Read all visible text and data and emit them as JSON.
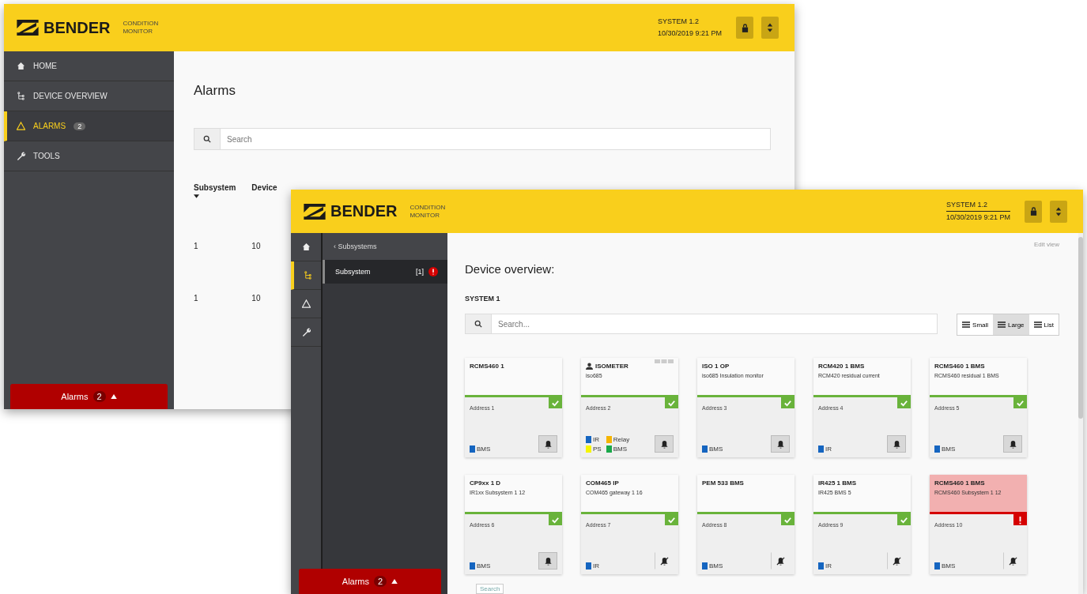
{
  "back_window": {
    "logo": "BENDER",
    "logo_subtitle": [
      "CONDITION",
      "MONITOR"
    ],
    "system": "SYSTEM 1.2",
    "datetime": "10/30/2019 9:21 PM",
    "menu": [
      {
        "label": "HOME",
        "selected": false
      },
      {
        "label": "DEVICE OVERVIEW",
        "selected": false
      },
      {
        "label": "ALARMS",
        "selected": true,
        "badge": "2"
      },
      {
        "label": "TOOLS",
        "selected": false
      }
    ],
    "alarm_button": {
      "label": "Alarms",
      "count": "2"
    },
    "title": "Alarms",
    "search": {
      "placeholder": "Search"
    },
    "table": {
      "columns": [
        "Subsystem",
        "Device"
      ],
      "rows": [
        [
          "1",
          "10"
        ],
        [
          "1",
          "10"
        ]
      ]
    }
  },
  "front_window": {
    "logo": "BENDER",
    "logo_subtitle": [
      "CONDITION",
      "MONITOR"
    ],
    "system": "SYSTEM 1.2",
    "datetime": "10/30/2019 9:21 PM",
    "rail": [
      {
        "selected": false
      },
      {
        "selected": true
      },
      {
        "selected": false
      },
      {
        "selected": false
      }
    ],
    "back_link": "‹ Subsystems",
    "subsystems": [
      {
        "label": "Subsystem",
        "count": "[1]",
        "alarm": true,
        "selected": true
      }
    ],
    "alarm_button": {
      "label": "Alarms",
      "count": "2"
    },
    "edit_link": "Edit view",
    "title": "Device overview:",
    "system_label": "SYSTEM 1",
    "search": {
      "placeholder": "Search..."
    },
    "views": [
      {
        "label": "Small",
        "selected": false
      },
      {
        "label": "Large",
        "selected": true
      },
      {
        "label": "List",
        "selected": false
      }
    ],
    "cards": [
      {
        "name": "RCMS460 1",
        "address": "Address 1",
        "alarm": false,
        "muted": false,
        "person": false,
        "tags": [
          {
            "label": "BMS",
            "color": "#1565c0"
          }
        ]
      },
      {
        "name": "ISOMETER",
        "type": "iso685",
        "address": "Address 2",
        "alarm": false,
        "muted": false,
        "person": true,
        "tags": [
          {
            "label": "IR",
            "color": "#1565c0"
          },
          {
            "label": "Relay",
            "color": "#f5b400"
          },
          {
            "label": "PS",
            "color": "#f5f500"
          },
          {
            "label": "BMS",
            "color": "#1aa84a"
          }
        ]
      },
      {
        "name": "ISO 1 OP",
        "type": "iso685 Insulation monitor",
        "address": "Address 3",
        "alarm": false,
        "muted": false,
        "person": false,
        "tags": [
          {
            "label": "BMS",
            "color": "#1565c0"
          }
        ]
      },
      {
        "name": "RCM420 1 BMS",
        "type": "RCM420 residual current",
        "address": "Address 4",
        "alarm": false,
        "muted": false,
        "person": false,
        "tags": [
          {
            "label": "IR",
            "color": "#1565c0"
          }
        ]
      },
      {
        "name": "RCMS460 1 BMS",
        "type": "RCMS460 residual 1 BMS",
        "address": "Address 5",
        "alarm": false,
        "muted": false,
        "person": false,
        "tags": [
          {
            "label": "BMS",
            "color": "#1565c0"
          }
        ]
      },
      {
        "name": "CP9xx 1 D",
        "type": "IR1xx Subsystem 1 12",
        "address": "Address 6",
        "alarm": false,
        "muted": false,
        "person": false,
        "tags": [
          {
            "label": "BMS",
            "color": "#1565c0"
          }
        ]
      },
      {
        "name": "COM465 IP",
        "type": "COM465 gateway 1 16",
        "address": "Address 7",
        "alarm": false,
        "muted": true,
        "person": false,
        "tags": [
          {
            "label": "IR",
            "color": "#1565c0"
          }
        ]
      },
      {
        "name": "PEM 533 BMS",
        "address": "Address 8",
        "alarm": false,
        "muted": true,
        "person": false,
        "tags": [
          {
            "label": "BMS",
            "color": "#1565c0"
          }
        ]
      },
      {
        "name": "IR425 1 BMS",
        "type": "IR425 BMS 5",
        "address": "Address 9",
        "alarm": false,
        "muted": true,
        "person": false,
        "tags": [
          {
            "label": "IR",
            "color": "#1565c0"
          }
        ]
      },
      {
        "name": "RCMS460 1 BMS",
        "type": "RCMS460 Subsystem 1 12",
        "address": "Address 10",
        "alarm": true,
        "muted": true,
        "person": false,
        "tags": [
          {
            "label": "BMS",
            "color": "#1565c0"
          }
        ]
      }
    ],
    "tooltip": "Search"
  }
}
